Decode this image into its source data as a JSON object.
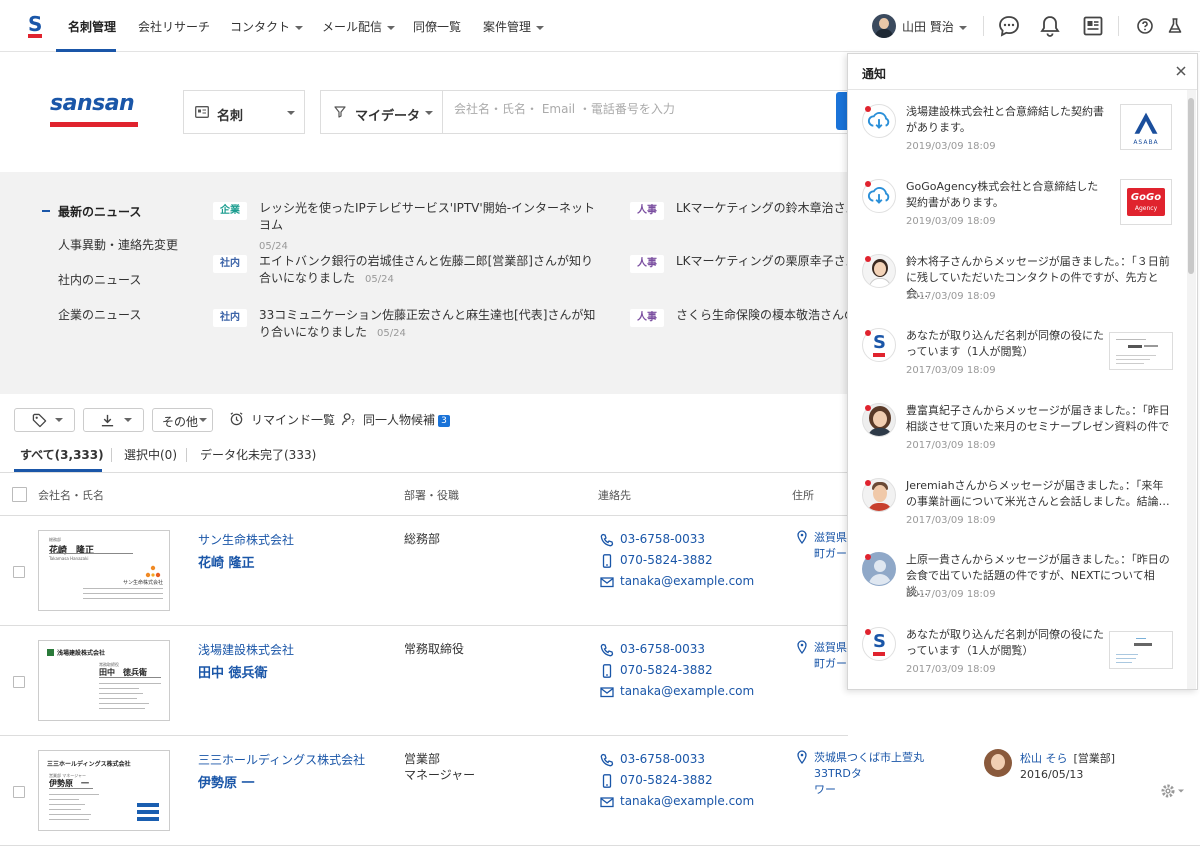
{
  "nav": {
    "items": [
      {
        "label": "名刺管理",
        "active": true,
        "dropdown": false
      },
      {
        "label": "会社リサーチ",
        "active": false,
        "dropdown": false
      },
      {
        "label": "コンタクト",
        "active": false,
        "dropdown": true
      },
      {
        "label": "メール配信",
        "active": false,
        "dropdown": true
      },
      {
        "label": "同僚一覧",
        "active": false,
        "dropdown": false
      },
      {
        "label": "案件管理",
        "active": false,
        "dropdown": true
      }
    ],
    "user_name": "山田 賢治"
  },
  "brand": {
    "logo_text": "sansan",
    "primary": "#1a56a8",
    "accent": "#e0232e"
  },
  "search": {
    "scope_label": "名刺",
    "filter_label": "マイデータ",
    "placeholder": "会社名・氏名・ Email ・電話番号を入力"
  },
  "news": {
    "categories": [
      "最新のニュース",
      "人事異動・連絡先変更",
      "社内のニュース",
      "企業のニュース"
    ],
    "items": [
      {
        "tag": "企業",
        "title": "レッシ光を使ったIPテレビサービス'IPTV'開始-インターネットヨム",
        "date": "05/24"
      },
      {
        "tag": "人事",
        "title": "LKマーケティングの鈴木章治さんの"
      },
      {
        "tag": "社内",
        "title": "エイトバンク銀行の岩城佳さんと佐藤二郎[営業部]さんが知り合いになりました",
        "date": "05/24"
      },
      {
        "tag": "人事",
        "title": "LKマーケティングの栗原幸子さんの"
      },
      {
        "tag": "社内",
        "title": "33コミュニケーション佐藤正宏さんと麻生達也[代表]さんが知り合いになりました",
        "date": "05/24"
      },
      {
        "tag": "人事",
        "title": "さくら生命保険の榎本敬浩さんの役職"
      }
    ]
  },
  "toolbar": {
    "other_label": "その他",
    "remind_label": "リマインド一覧",
    "same_person_label": "同一人物候補",
    "same_person_count": "3"
  },
  "tabs": [
    "すべて(3,333)",
    "選択中(0)",
    "データ化未完了(333)"
  ],
  "table": {
    "headers": [
      "会社名・氏名",
      "部署・役職",
      "連絡先",
      "住所"
    ],
    "rows": [
      {
        "company": "サン生命株式会社",
        "name": "花崎 隆正",
        "dept": "総務部",
        "title": "",
        "phone": "03-6758-0033",
        "mobile": "070-5824-3882",
        "email": "tanaka@example.com",
        "address": "滋賀県",
        "address2": "町ガーテ",
        "card": {
          "name": "花崎　隆正",
          "sub": "Takamasa Hanazaki",
          "company": "サン生命株式会社"
        }
      },
      {
        "company": "浅場建設株式会社",
        "name": "田中 徳兵衛",
        "dept": "常務取締役",
        "title": "",
        "phone": "03-6758-0033",
        "mobile": "070-5824-3882",
        "email": "tanaka@example.com",
        "address": "滋賀県",
        "address2": "町ガーテ",
        "card": {
          "name": "田中　徳兵衛",
          "company": "浅場建設株式会社"
        }
      },
      {
        "company": "三三ホールディングス株式会社",
        "name": "伊勢原 一",
        "dept": "営業部",
        "title": "マネージャー",
        "phone": "03-6758-0033",
        "mobile": "070-5824-3882",
        "email": "tanaka@example.com",
        "address": "茨城県つくば市上萱丸33TRDタ",
        "address2": "ワー",
        "owner": {
          "name": "松山 そら",
          "dept": "[営業部]",
          "date": "2016/05/13"
        },
        "card": {
          "name": "伊勢原　一",
          "company": "三三ホールディングス株式会社"
        }
      }
    ]
  },
  "notifications": {
    "title": "通知",
    "items": [
      {
        "text": "浅場建設株式会社と合意締結した契約書があります。",
        "date": "2019/03/09 18:09",
        "icon": "cloud-icon",
        "thumb": "ASABA"
      },
      {
        "text": "GoGoAgency株式会社と合意締結した契約書があります。",
        "date": "2019/03/09 18:09",
        "icon": "cloud-icon",
        "thumb_line1": "GoGo",
        "thumb_line2": "Agency"
      },
      {
        "text": "鈴木将子さんからメッセージが届きました。：「３日前に残していただいたコンタクトの件ですが、先方と会…",
        "date": "2017/03/09 18:09",
        "icon": "avatar"
      },
      {
        "text": "あなたが取り込んだ名刺が同僚の役にたっています（1人が閲覧）",
        "date": "2017/03/09 18:09",
        "icon": "sansan-icon",
        "thumb": "card"
      },
      {
        "text": "豊富真紀子さんからメッセージが届きました。：「昨日相談させて頂いた来月のセミナープレゼン資料の件で",
        "date": "2017/03/09 18:09",
        "icon": "avatar"
      },
      {
        "text": "Jeremiahさんからメッセージが届きました。：「来年の事業計画について米光さんと会話しました。結論…",
        "date": "2017/03/09 18:09",
        "icon": "avatar"
      },
      {
        "text": "上原一貴さんからメッセージが届きました。：「昨日の会食で出ていた話題の件ですが、NEXTについて相談…",
        "date": "2017/03/09 18:09",
        "icon": "avatar"
      },
      {
        "text": "あなたが取り込んだ名刺が同僚の役にたっています（1人が閲覧）",
        "date": "2017/03/09 18:09",
        "icon": "sansan-icon",
        "thumb": "card"
      }
    ]
  }
}
